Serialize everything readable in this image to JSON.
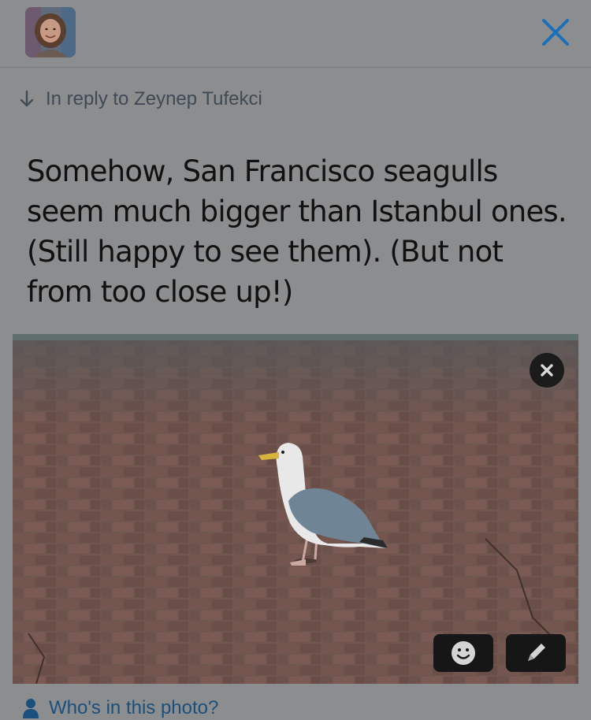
{
  "header": {
    "avatar_icon": "user-avatar",
    "close_icon": "close-icon",
    "accent_color": "#1b6fb8"
  },
  "reply": {
    "icon": "arrow-down-icon",
    "label": "In reply to Zeynep Tufekci"
  },
  "tweet": {
    "text": "Somehow, San Francisco seagulls seem much bigger than Istanbul ones. (Still happy to see them). (But not from too close up!)"
  },
  "photo": {
    "subject": "seagull on brick pavement",
    "remove_icon": "close-icon",
    "sticker_icon": "smiley-icon",
    "edit_icon": "pencil-icon"
  },
  "tag_people": {
    "icon": "person-icon",
    "label": "Who's in this photo?"
  }
}
